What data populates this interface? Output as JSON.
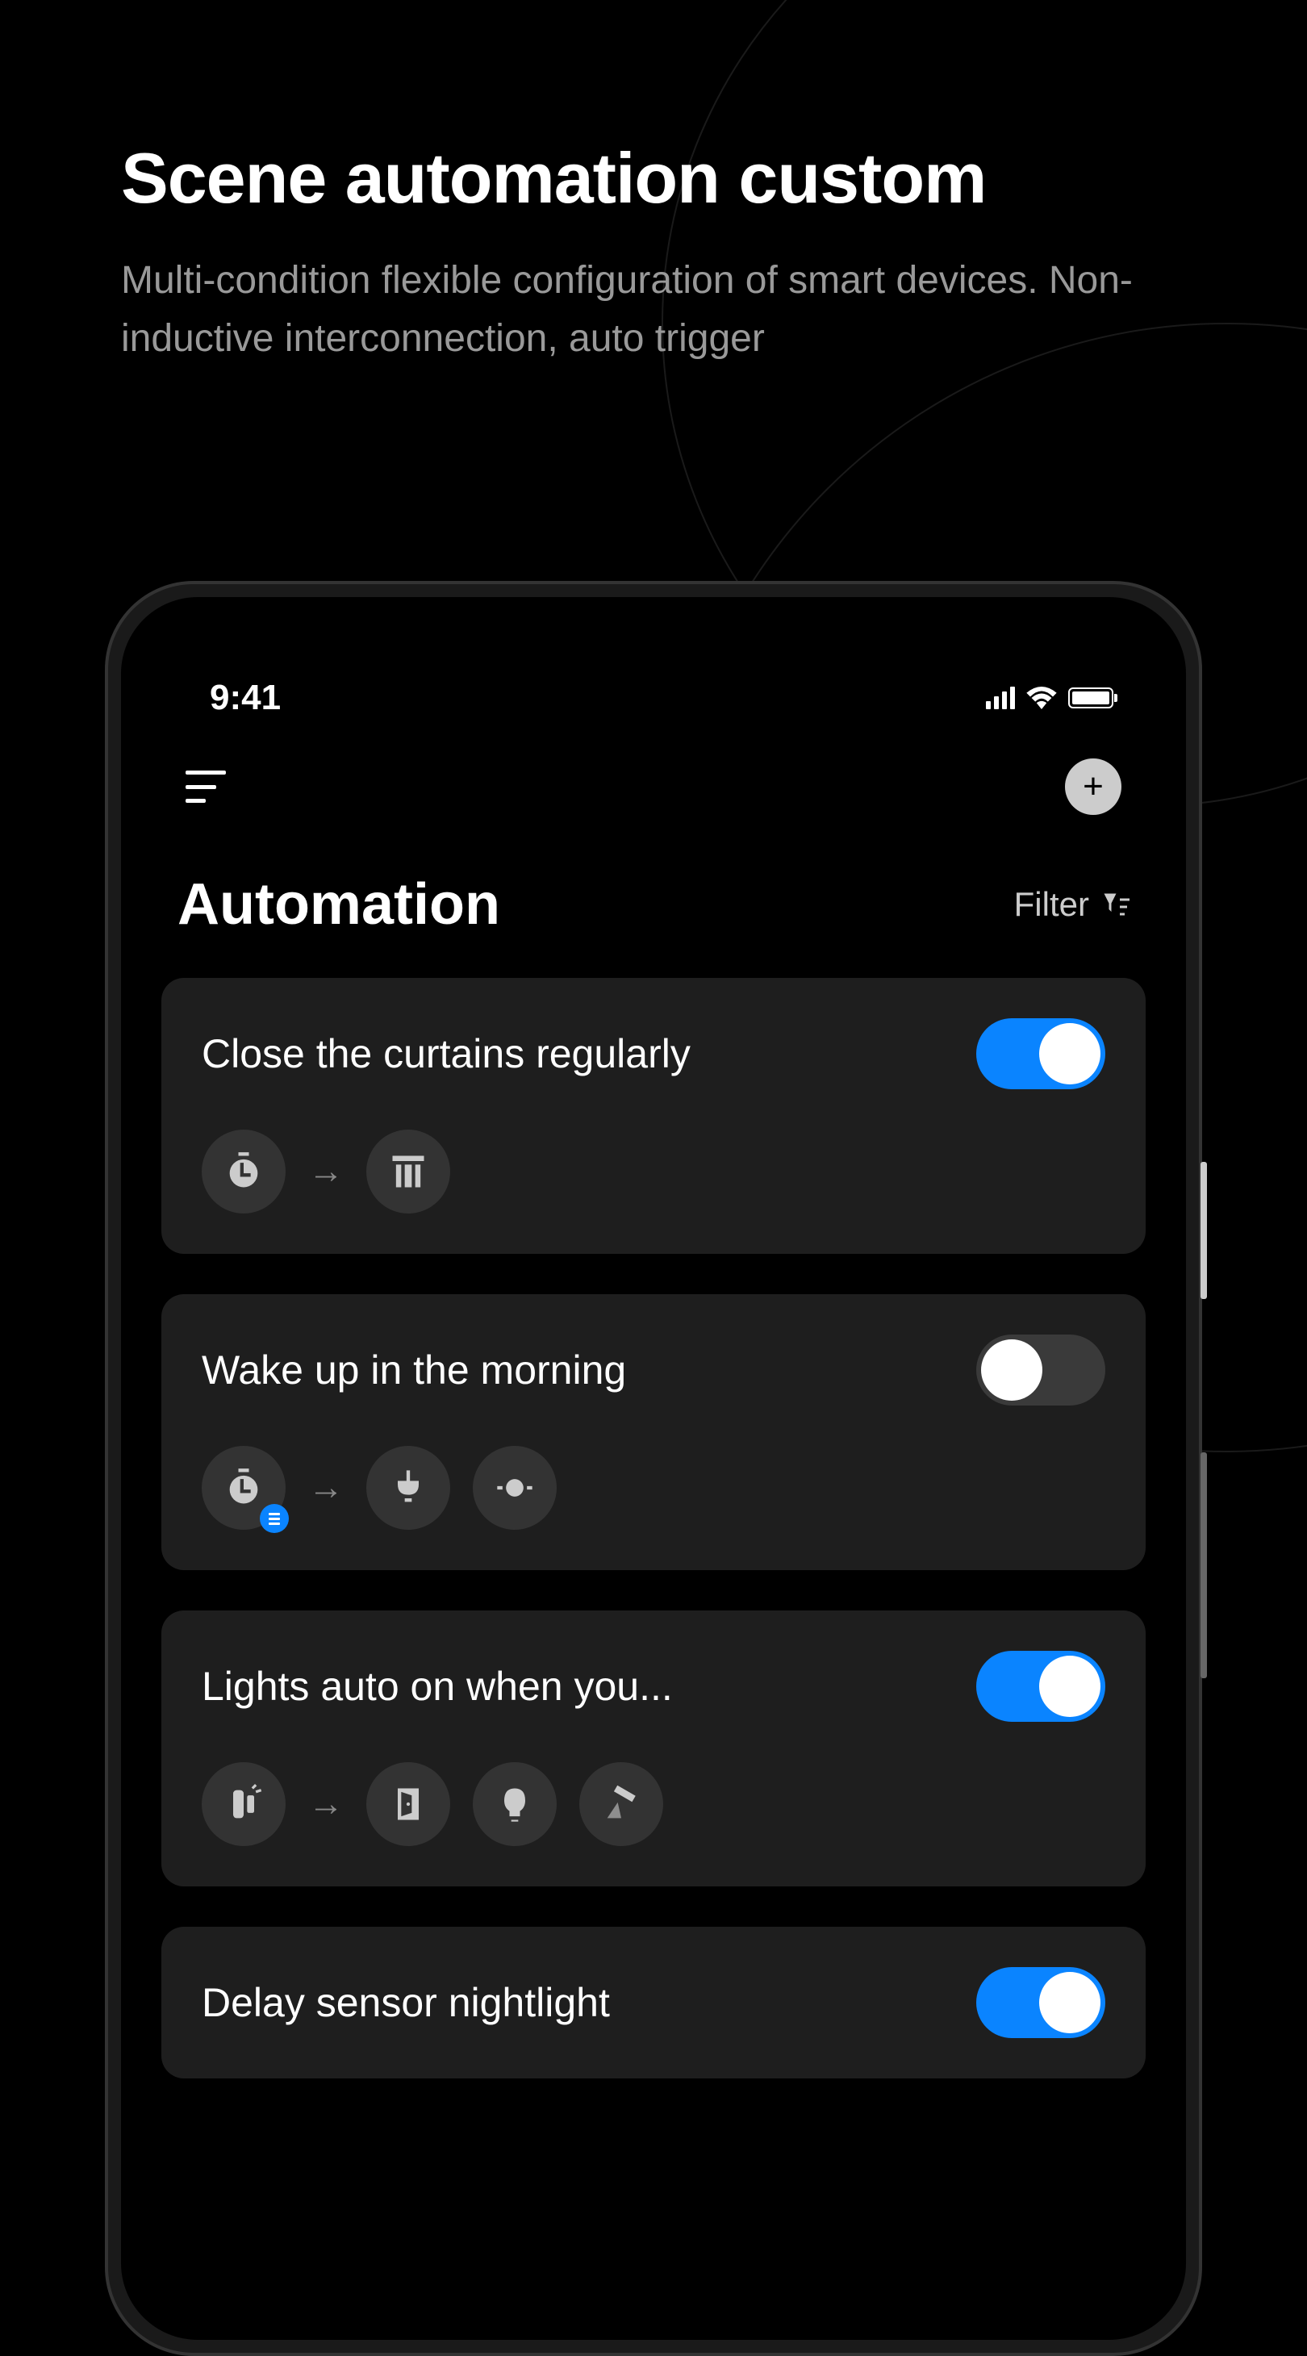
{
  "header": {
    "title": "Scene automation custom",
    "subtitle": "Multi-condition flexible configuration of smart devices. Non-inductive interconnection, auto trigger"
  },
  "statusBar": {
    "time": "9:41"
  },
  "app": {
    "pageTitle": "Automation",
    "filterLabel": "Filter"
  },
  "automations": [
    {
      "title": "Close the curtains regularly",
      "enabled": true,
      "triggerIcon": "timer",
      "triggerHasBadge": false,
      "actionIcons": [
        "curtain"
      ]
    },
    {
      "title": "Wake up in the morning",
      "enabled": false,
      "triggerIcon": "timer",
      "triggerHasBadge": true,
      "actionIcons": [
        "pendant-light",
        "brightness"
      ]
    },
    {
      "title": "Lights auto on when you...",
      "enabled": true,
      "triggerIcon": "door-sensor",
      "triggerHasBadge": false,
      "actionIcons": [
        "door",
        "bulb",
        "spotlight"
      ]
    },
    {
      "title": "Delay sensor nightlight",
      "enabled": true,
      "triggerIcon": "",
      "triggerHasBadge": false,
      "actionIcons": []
    }
  ]
}
